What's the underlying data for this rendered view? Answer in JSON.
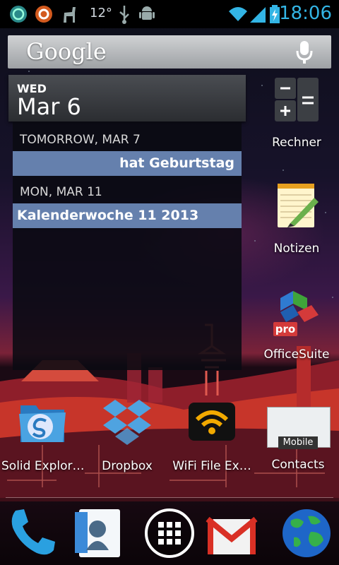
{
  "status_bar": {
    "time": "18:06",
    "temperature": "12°",
    "icons": [
      "sync-icon",
      "contacts-sync-icon",
      "llama-icon",
      "usb-icon",
      "android-debug-icon",
      "wifi-icon",
      "signal-icon",
      "battery-charging-icon"
    ]
  },
  "search": {
    "label": "Google",
    "icon": "mic-icon"
  },
  "calendar": {
    "day_of_week": "WED",
    "date": "Mar 6",
    "entries": [
      {
        "day": "TOMORROW, MAR 7",
        "event": "hat Geburtstag"
      },
      {
        "day": "MON, MAR 11",
        "event": "Kalenderwoche 11 2013"
      }
    ]
  },
  "right_apps": [
    {
      "label": "Rechner",
      "icon": "calculator-icon"
    },
    {
      "label": "Notizen",
      "icon": "notepad-icon"
    },
    {
      "label": "OfficeSuite",
      "icon": "officesuite-icon",
      "badge": "pro"
    }
  ],
  "home_apps": [
    {
      "label": "Solid Explor…",
      "icon": "solid-explorer-icon"
    },
    {
      "label": "Dropbox",
      "icon": "dropbox-icon"
    },
    {
      "label": "WiFi File Ex…",
      "icon": "wifi-file-explorer-icon"
    },
    {
      "label": "Contacts",
      "icon": "contacts-folder-icon",
      "sublabel": "Mobile"
    }
  ],
  "dock": [
    {
      "icon": "phone-icon"
    },
    {
      "icon": "people-icon"
    },
    {
      "icon": "all-apps-icon"
    },
    {
      "icon": "gmail-icon"
    },
    {
      "icon": "browser-globe-icon"
    }
  ],
  "colors": {
    "clock": "#33b5e5",
    "event_bar": "#6580ad"
  }
}
